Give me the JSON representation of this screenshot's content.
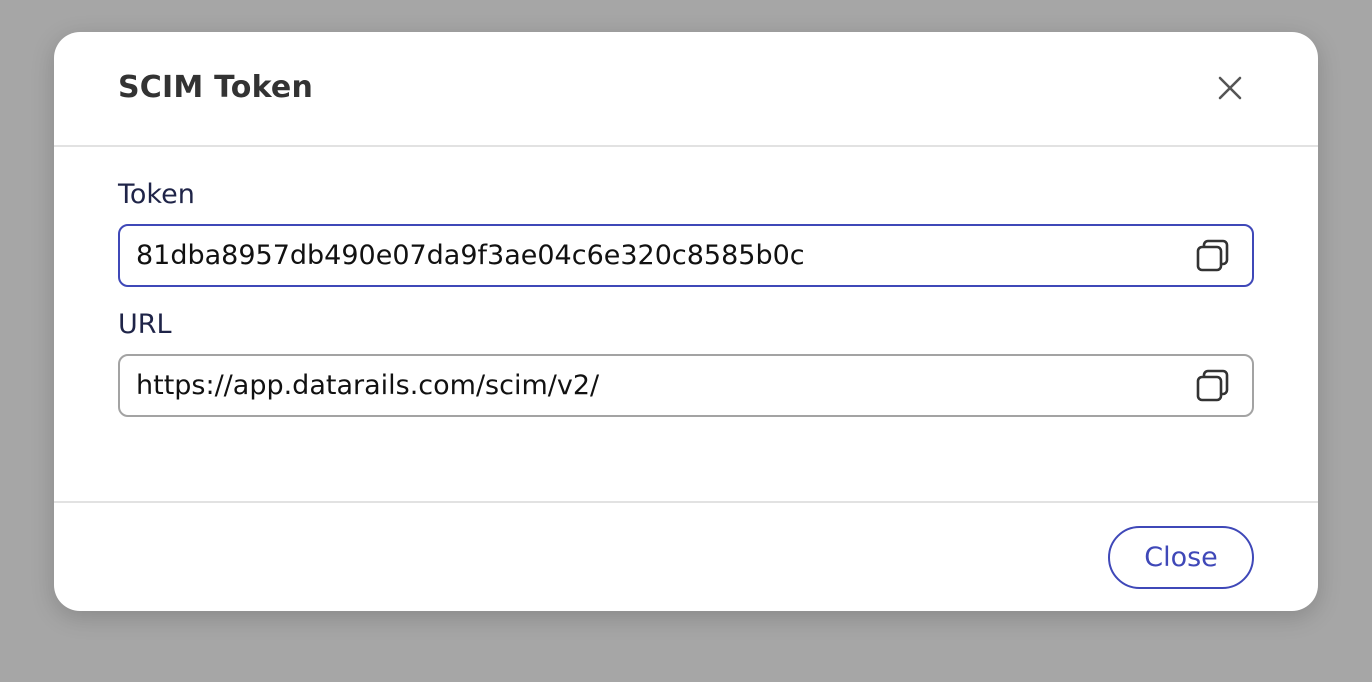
{
  "dialog": {
    "title": "SCIM Token",
    "close_icon": "close-icon"
  },
  "fields": {
    "token": {
      "label": "Token",
      "value": "81dba8957db490e07da9f3ae04c6e320c8585b0c",
      "copy_icon": "copy-icon"
    },
    "url": {
      "label": "URL",
      "value": "https://app.datarails.com/scim/v2/",
      "copy_icon": "copy-icon"
    }
  },
  "footer": {
    "close_label": "Close"
  },
  "colors": {
    "accent": "#3f48b8",
    "backdrop": "#a6a6a6",
    "label_text": "#1f2448"
  }
}
